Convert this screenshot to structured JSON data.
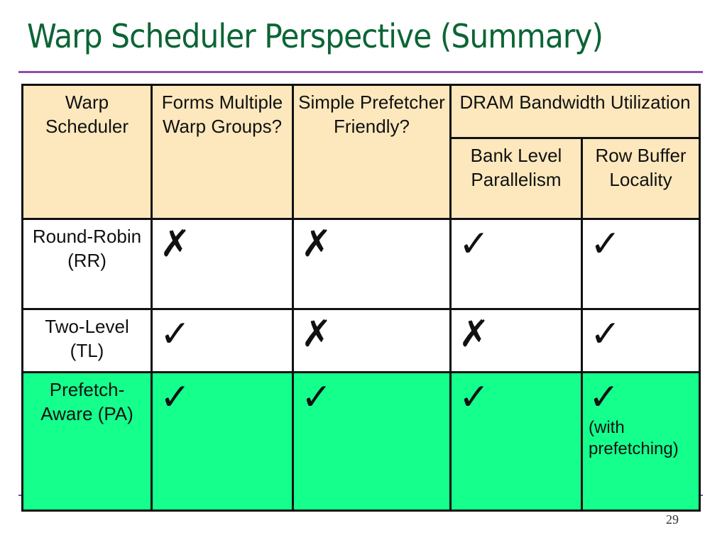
{
  "slide": {
    "title": "Warp Scheduler Perspective (Summary)",
    "page_number": "29"
  },
  "colors": {
    "title": "#0b6535",
    "rule": "#8e4fb0",
    "header_bg": "#fde8bd",
    "highlight_row_bg": "#14ff8c"
  },
  "table": {
    "headers": {
      "warp_scheduler": "Warp Scheduler",
      "forms_groups": "Forms Multiple Warp Groups?",
      "prefetcher_friendly": "Simple Prefetcher Friendly?",
      "dram_group": "DRAM Bandwidth Utilization",
      "bank_level": "Bank Level Parallelism",
      "row_buffer": "Row Buffer Locality"
    },
    "rows": [
      {
        "name": "Round-Robin (RR)",
        "forms_groups": "✗",
        "forms_groups_icon": "cross-icon",
        "prefetcher_friendly": "✗",
        "bank_level": "✓",
        "row_buffer": "✓",
        "row_buffer_note": ""
      },
      {
        "name": "Two-Level (TL)",
        "forms_groups": "✓",
        "prefetcher_friendly": "✗",
        "bank_level": "✗",
        "row_buffer": "✓",
        "row_buffer_note": ""
      },
      {
        "name": "Prefetch-Aware (PA)",
        "forms_groups": "✓",
        "prefetcher_friendly": "✓",
        "bank_level": "✓",
        "row_buffer": "✓",
        "row_buffer_note": "(with prefetching)"
      }
    ]
  }
}
